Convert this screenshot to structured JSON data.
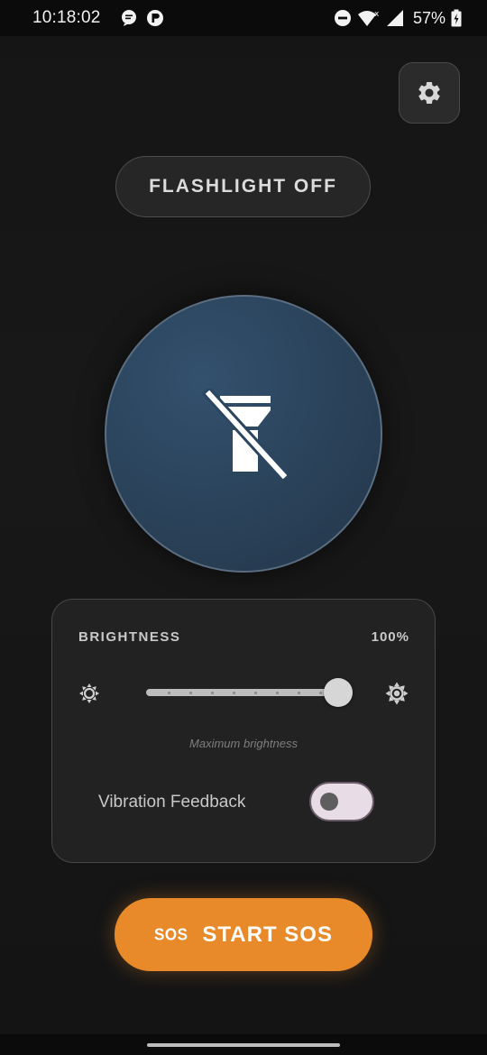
{
  "status_bar": {
    "time": "10:18:02",
    "battery": "57%",
    "left_icons": [
      "chat-icon",
      "app-notification-icon"
    ],
    "right_icons": [
      "do-not-disturb-icon",
      "wifi-icon",
      "signal-icon",
      "battery-icon"
    ]
  },
  "header": {
    "settings_icon": "gear-icon"
  },
  "flashlight": {
    "status_label": "FLASHLIGHT OFF",
    "is_on": false,
    "button_icon": "flashlight-off-icon"
  },
  "brightness": {
    "label": "BRIGHTNESS",
    "value_label": "100%",
    "level": 1.0,
    "caption": "Maximum brightness",
    "min_icon": "brightness-low-icon",
    "max_icon": "brightness-high-icon"
  },
  "vibration": {
    "label": "Vibration Feedback",
    "enabled": false
  },
  "sos": {
    "icon_text": "SOS",
    "label": "START SOS"
  },
  "colors": {
    "accent": "#e88a2a",
    "circle": "#2a4259",
    "background": "#151515",
    "card": "#222222"
  }
}
